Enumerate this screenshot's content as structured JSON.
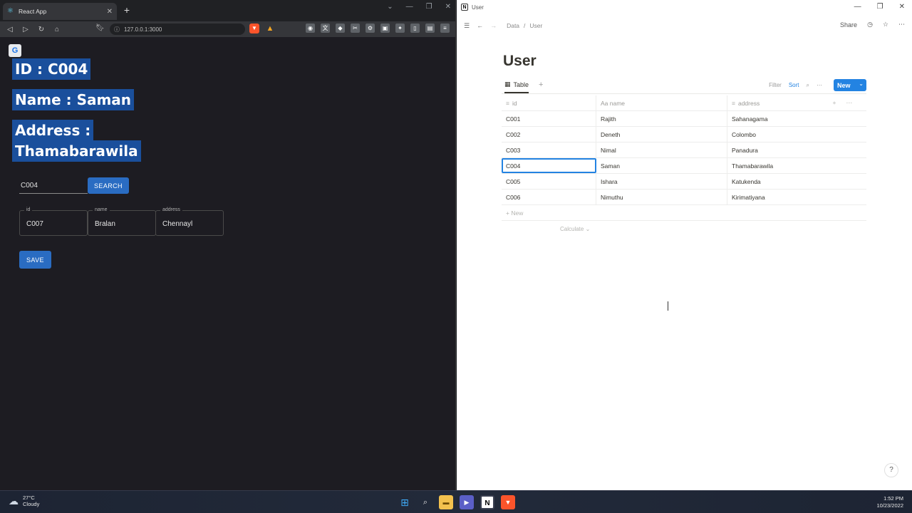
{
  "left_browser": {
    "tab_title": "React App",
    "url": "127.0.0.1:3000",
    "page": {
      "id_heading": "ID : C004",
      "name_heading": "Name : Saman",
      "address_heading_1": "Address :",
      "address_heading_2": "Thamabarawila",
      "search_value": "C004",
      "search_button": "SEARCH",
      "fields": [
        {
          "label": "id",
          "value": "C007"
        },
        {
          "label": "name",
          "value": "Bralan"
        },
        {
          "label": "address",
          "value": "Chennayl"
        }
      ],
      "save_button": "SAVE"
    }
  },
  "right_window": {
    "window_title": "User",
    "breadcrumb": [
      "Data",
      "User"
    ],
    "share_label": "Share",
    "page_title": "User",
    "view_tab": "Table",
    "tools": {
      "filter": "Filter",
      "sort": "Sort"
    },
    "new_button": "New",
    "columns": [
      "id",
      "Aa name",
      "address"
    ],
    "rows": [
      {
        "id": "C001",
        "name": "Rajith",
        "address": "Sahanagama"
      },
      {
        "id": "C002",
        "name": "Deneth",
        "address": "Colombo"
      },
      {
        "id": "C003",
        "name": "Nimal",
        "address": "Panadura"
      },
      {
        "id": "C004",
        "name": "Saman",
        "address": "Thamabarawila"
      },
      {
        "id": "C005",
        "name": "Ishara",
        "address": "Katukenda"
      },
      {
        "id": "C006",
        "name": "Nimuthu",
        "address": "Kirimatiyana"
      }
    ],
    "new_row_label": "+ New",
    "calculate_label": "Calculate",
    "help_label": "?"
  },
  "taskbar": {
    "temperature": "27°C",
    "weather": "Cloudy",
    "time": "1:52 PM",
    "date": "10/23/2022"
  }
}
